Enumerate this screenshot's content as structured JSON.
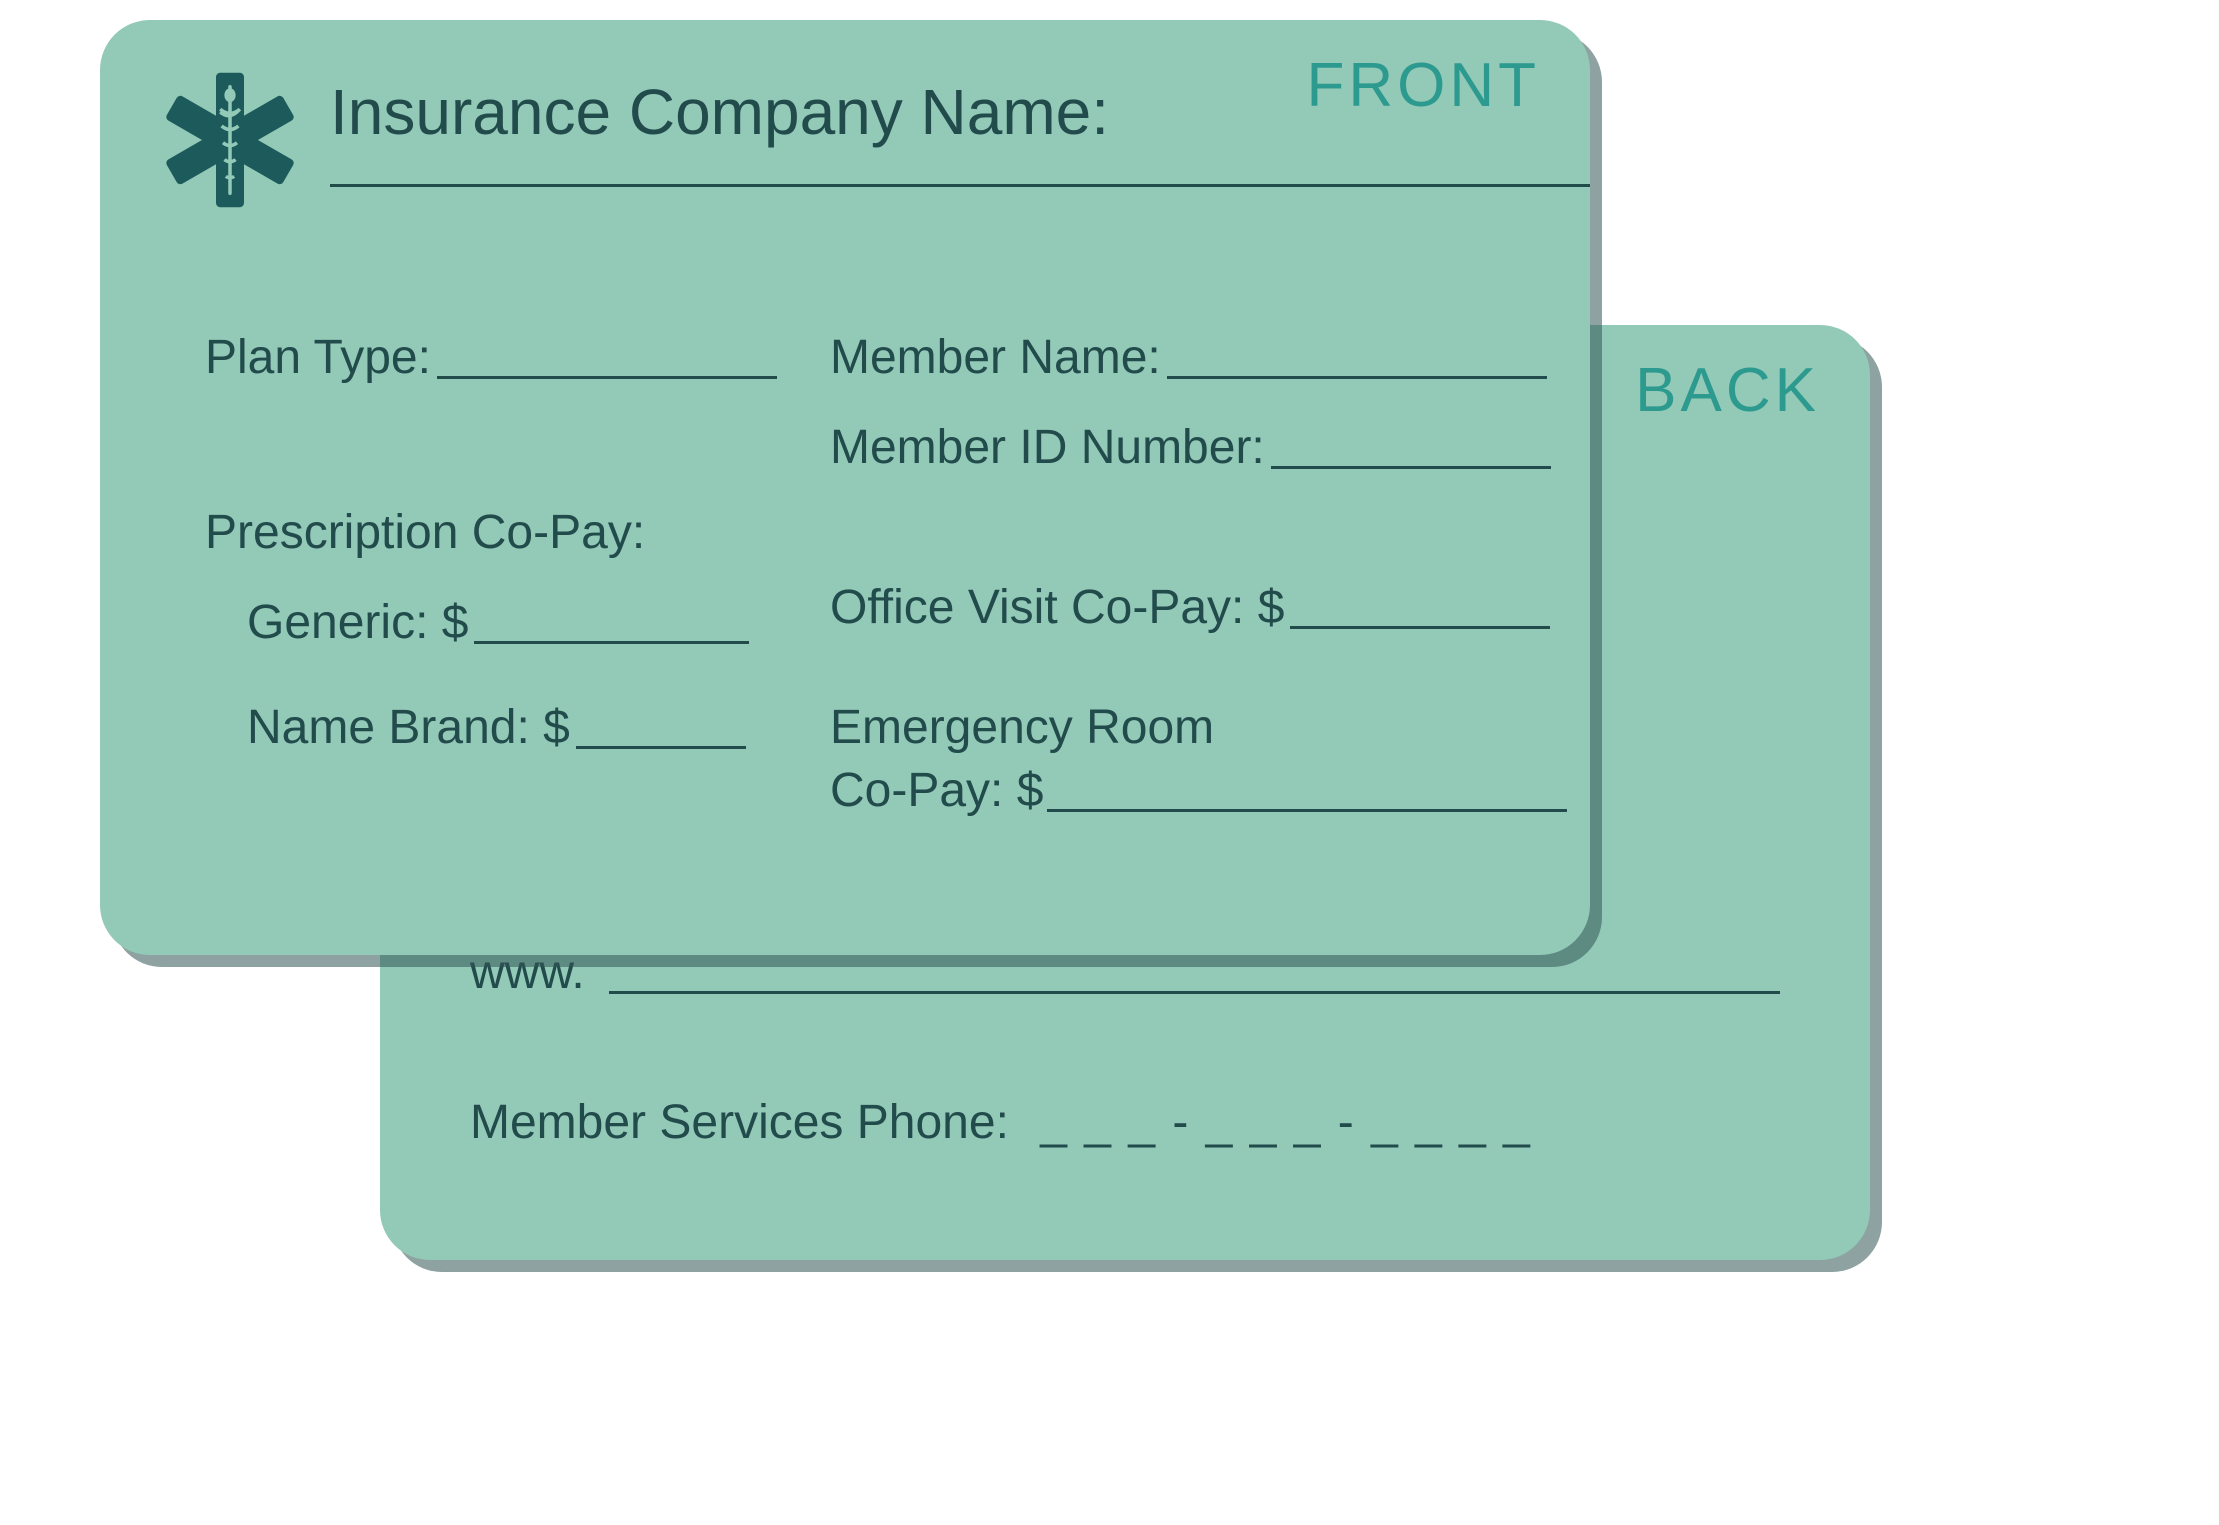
{
  "front": {
    "badge": "FRONT",
    "company_label": "Insurance Company Name:",
    "plan_type_label": "Plan Type:",
    "rx_copay_label": "Prescription Co-Pay:",
    "generic_label": "Generic: $",
    "name_brand_label": "Name Brand: $",
    "member_name_label": "Member Name:",
    "member_id_label": "Member ID Number:",
    "office_visit_label": "Office Visit Co-Pay: $",
    "er_label_line1": "Emergency Room",
    "er_label_line2": "Co-Pay: $"
  },
  "back": {
    "badge": "BACK",
    "www_label": "www.",
    "phone_label": "Member Services Phone:",
    "phone_placeholder": "_  _  _   -   _  _  _   -   _  _  _  _"
  },
  "colors": {
    "card_bg": "#93c9b7",
    "text": "#224b4c",
    "badge": "#2d9a8f"
  }
}
